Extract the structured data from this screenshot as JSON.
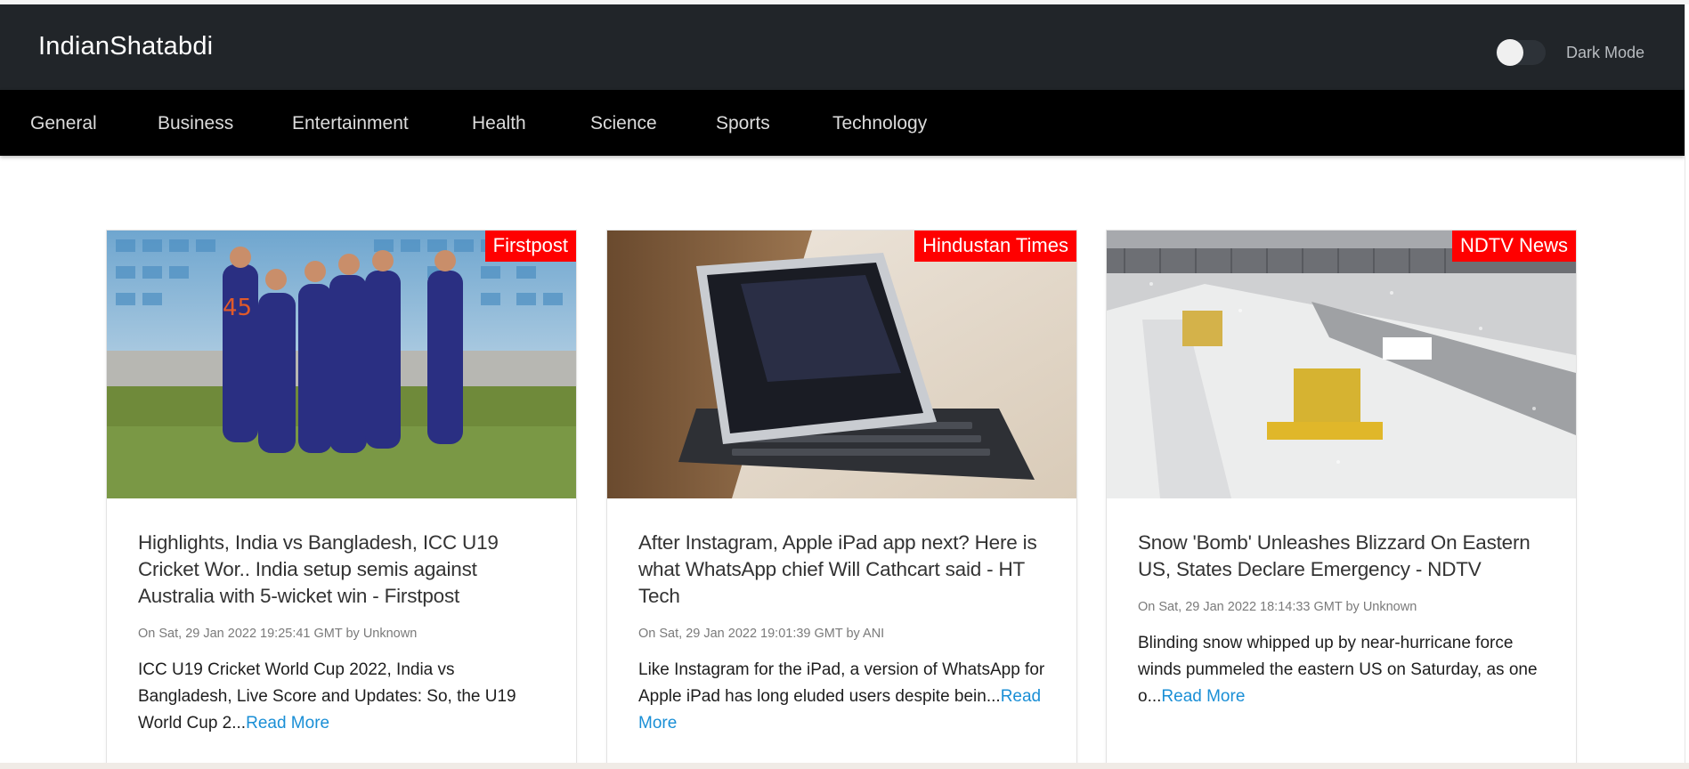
{
  "brand": "IndianShatabdi",
  "dark_mode": {
    "label": "Dark Mode",
    "enabled": false
  },
  "nav": [
    "General",
    "Business",
    "Entertainment",
    "Health",
    "Science",
    "Sports",
    "Technology"
  ],
  "colors": {
    "header_bg": "#212529",
    "navbar_bg": "#000000",
    "badge": "#ff0000",
    "link": "#1a8fd6"
  },
  "articles": [
    {
      "source": "Firstpost",
      "image": "cricket-team-celebration-photo",
      "title": "Highlights, India vs Bangladesh, ICC U19 Cricket Wor.. India setup semis against Australia with 5-wicket win - Firstpost",
      "meta": "On Sat, 29 Jan 2022 19:25:41 GMT by Unknown",
      "description": "ICC U19 Cricket World Cup 2022, India vs Bangladesh, Live Score and Updates: So, the U19 World Cup 2...",
      "read_more": "Read More"
    },
    {
      "source": "Hindustan Times",
      "image": "ipad-with-keyboard-photo",
      "title": "After Instagram, Apple iPad app next? Here is what WhatsApp chief Will Cathcart said - HT Tech",
      "meta": "On Sat, 29 Jan 2022 19:01:39 GMT by ANI",
      "description": "Like Instagram for the iPad, a version of WhatsApp for Apple iPad has long eluded users despite bein...",
      "read_more": "Read More"
    },
    {
      "source": "NDTV News",
      "image": "snow-plow-highway-photo",
      "title": "Snow 'Bomb' Unleashes Blizzard On Eastern US, States Declare Emergency - NDTV",
      "meta": "On Sat, 29 Jan 2022 18:14:33 GMT by Unknown",
      "description": "Blinding snow whipped up by near-hurricane force winds pummeled the eastern US on Saturday, as one o...",
      "read_more": "Read More"
    }
  ]
}
